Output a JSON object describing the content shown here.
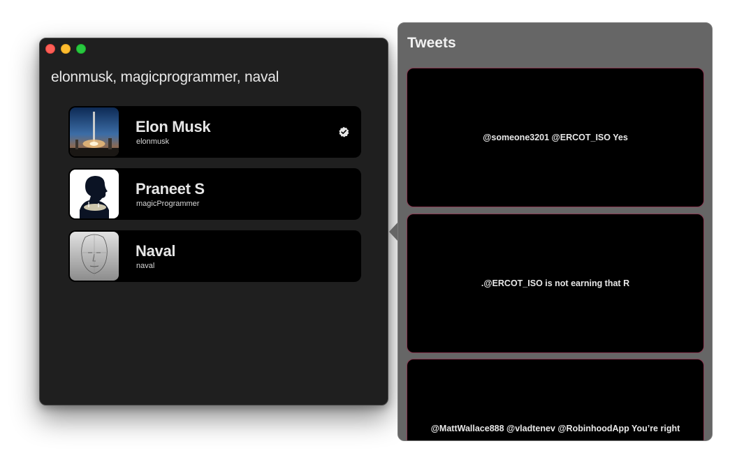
{
  "window": {
    "title": "elonmusk, magicprogrammer, naval"
  },
  "users": [
    {
      "name": "Elon Musk",
      "handle": "elonmusk",
      "verified": true,
      "avatar_icon": "rocket-launch-avatar"
    },
    {
      "name": "Praneet S",
      "handle": "magicProgrammer",
      "verified": false,
      "avatar_icon": "silhouette-avatar"
    },
    {
      "name": "Naval",
      "handle": "naval",
      "verified": false,
      "avatar_icon": "sketch-face-avatar"
    }
  ],
  "tweets_panel": {
    "title": "Tweets",
    "tweets": [
      {
        "text": "@someone3201 @ERCOT_ISO Yes"
      },
      {
        "text": ".@ERCOT_ISO is not earning that R"
      },
      {
        "text": "@MattWallace888 @vladtenev @RobinhoodApp You’re right"
      }
    ]
  },
  "colors": {
    "window_bg": "#1f1f1f",
    "card_bg": "#000000",
    "popover_bg": "#666666",
    "tweet_border": "#8a3a52"
  }
}
